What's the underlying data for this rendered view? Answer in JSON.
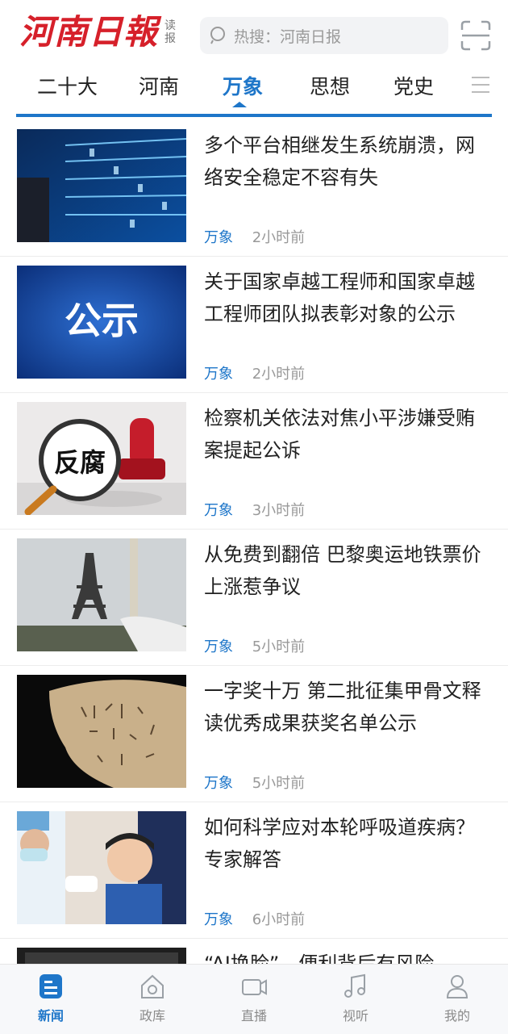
{
  "header": {
    "logo_text": "河南日報",
    "logo_sub_1": "读",
    "logo_sub_2": "报",
    "search_placeholder": "热搜：河南日报"
  },
  "tabs": [
    {
      "label": "二十大"
    },
    {
      "label": "河南"
    },
    {
      "label": "万象"
    },
    {
      "label": "思想"
    },
    {
      "label": "党史"
    }
  ],
  "news": [
    {
      "title": "多个平台相继发生系统崩溃，网络安全稳定不容有失",
      "source": "万象",
      "time": "2小时前",
      "thumb": "server-lights"
    },
    {
      "title": "关于国家卓越工程师和国家卓越工程师团队拟表彰对象的公示",
      "source": "万象",
      "time": "2小时前",
      "thumb": "公示"
    },
    {
      "title": "检察机关依法对焦小平涉嫌受贿案提起公诉",
      "source": "万象",
      "time": "3小时前",
      "thumb": "反腐"
    },
    {
      "title": "从免费到翻倍 巴黎奥运地铁票价上涨惹争议",
      "source": "万象",
      "time": "5小时前",
      "thumb": "eiffel-torch"
    },
    {
      "title": "一字奖十万 第二批征集甲骨文释读优秀成果获奖名单公示",
      "source": "万象",
      "time": "5小时前",
      "thumb": "oracle-bone"
    },
    {
      "title": "如何科学应对本轮呼吸道疾病？专家解答",
      "source": "万象",
      "time": "6小时前",
      "thumb": "child-doctor"
    },
    {
      "title": "“AI换脸”、便利背后有风险",
      "source": "",
      "time": "",
      "thumb": "device"
    }
  ],
  "bottom_nav": [
    {
      "label": "新闻",
      "icon": "news-icon",
      "active": true
    },
    {
      "label": "政库",
      "icon": "house-icon",
      "active": false
    },
    {
      "label": "直播",
      "icon": "camera-icon",
      "active": false
    },
    {
      "label": "视听",
      "icon": "music-icon",
      "active": false
    },
    {
      "label": "我的",
      "icon": "user-icon",
      "active": false
    }
  ],
  "colors": {
    "accent": "#1e76c9",
    "brand": "#d6202a"
  }
}
